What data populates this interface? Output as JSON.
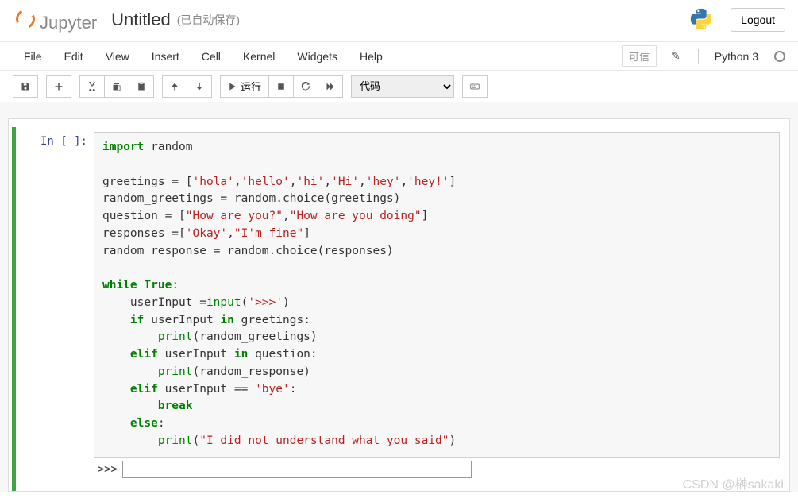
{
  "header": {
    "logo_text": "Jupyter",
    "notebook_title": "Untitled",
    "autosave_status": "(已自动保存)",
    "logout_label": "Logout"
  },
  "menubar": {
    "items": [
      "File",
      "Edit",
      "View",
      "Insert",
      "Cell",
      "Kernel",
      "Widgets",
      "Help"
    ],
    "trusted_label": "可信",
    "kernel_name": "Python 3"
  },
  "toolbar": {
    "run_label": "运行",
    "cell_type_selected": "代码"
  },
  "cell": {
    "prompt": "In [ ]:",
    "code_tokens": [
      [
        {
          "t": "kw",
          "v": "import"
        },
        {
          "t": "",
          "v": " random"
        }
      ],
      [],
      [
        {
          "t": "",
          "v": "greetings = ["
        },
        {
          "t": "str",
          "v": "'hola'"
        },
        {
          "t": "",
          "v": ","
        },
        {
          "t": "str",
          "v": "'hello'"
        },
        {
          "t": "",
          "v": ","
        },
        {
          "t": "str",
          "v": "'hi'"
        },
        {
          "t": "",
          "v": ","
        },
        {
          "t": "str",
          "v": "'Hi'"
        },
        {
          "t": "",
          "v": ","
        },
        {
          "t": "str",
          "v": "'hey'"
        },
        {
          "t": "",
          "v": ","
        },
        {
          "t": "str",
          "v": "'hey!'"
        },
        {
          "t": "",
          "v": "]"
        }
      ],
      [
        {
          "t": "",
          "v": "random_greetings = random.choice(greetings)"
        }
      ],
      [
        {
          "t": "",
          "v": "question = ["
        },
        {
          "t": "str",
          "v": "\"How are you?\""
        },
        {
          "t": "",
          "v": ","
        },
        {
          "t": "str",
          "v": "\"How are you doing\""
        },
        {
          "t": "",
          "v": "]"
        }
      ],
      [
        {
          "t": "",
          "v": "responses =["
        },
        {
          "t": "str",
          "v": "'Okay'"
        },
        {
          "t": "",
          "v": ","
        },
        {
          "t": "str",
          "v": "\"I'm fine\""
        },
        {
          "t": "",
          "v": "]"
        }
      ],
      [
        {
          "t": "",
          "v": "random_response = random.choice(responses)"
        }
      ],
      [],
      [
        {
          "t": "kw",
          "v": "while"
        },
        {
          "t": "",
          "v": " "
        },
        {
          "t": "kw",
          "v": "True"
        },
        {
          "t": "",
          "v": ":"
        }
      ],
      [
        {
          "t": "",
          "v": "    userInput ="
        },
        {
          "t": "bn",
          "v": "input"
        },
        {
          "t": "",
          "v": "("
        },
        {
          "t": "str",
          "v": "'>>>'"
        },
        {
          "t": "",
          "v": ")"
        }
      ],
      [
        {
          "t": "",
          "v": "    "
        },
        {
          "t": "kw",
          "v": "if"
        },
        {
          "t": "",
          "v": " userInput "
        },
        {
          "t": "kw",
          "v": "in"
        },
        {
          "t": "",
          "v": " greetings:"
        }
      ],
      [
        {
          "t": "",
          "v": "        "
        },
        {
          "t": "bn",
          "v": "print"
        },
        {
          "t": "",
          "v": "(random_greetings)"
        }
      ],
      [
        {
          "t": "",
          "v": "    "
        },
        {
          "t": "kw",
          "v": "elif"
        },
        {
          "t": "",
          "v": " userInput "
        },
        {
          "t": "kw",
          "v": "in"
        },
        {
          "t": "",
          "v": " question:"
        }
      ],
      [
        {
          "t": "",
          "v": "        "
        },
        {
          "t": "bn",
          "v": "print"
        },
        {
          "t": "",
          "v": "(random_response)"
        }
      ],
      [
        {
          "t": "",
          "v": "    "
        },
        {
          "t": "kw",
          "v": "elif"
        },
        {
          "t": "",
          "v": " userInput == "
        },
        {
          "t": "str",
          "v": "'bye'"
        },
        {
          "t": "",
          "v": ":"
        }
      ],
      [
        {
          "t": "",
          "v": "        "
        },
        {
          "t": "kw",
          "v": "break"
        }
      ],
      [
        {
          "t": "",
          "v": "    "
        },
        {
          "t": "kw",
          "v": "else"
        },
        {
          "t": "",
          "v": ":"
        }
      ],
      [
        {
          "t": "",
          "v": "        "
        },
        {
          "t": "bn",
          "v": "print"
        },
        {
          "t": "",
          "v": "("
        },
        {
          "t": "str",
          "v": "\"I did not understand what you said\""
        },
        {
          "t": "",
          "v": ")"
        }
      ]
    ],
    "stdin_prompt": ">>>",
    "stdin_value": ""
  },
  "watermark": "CSDN @榊sakaki"
}
